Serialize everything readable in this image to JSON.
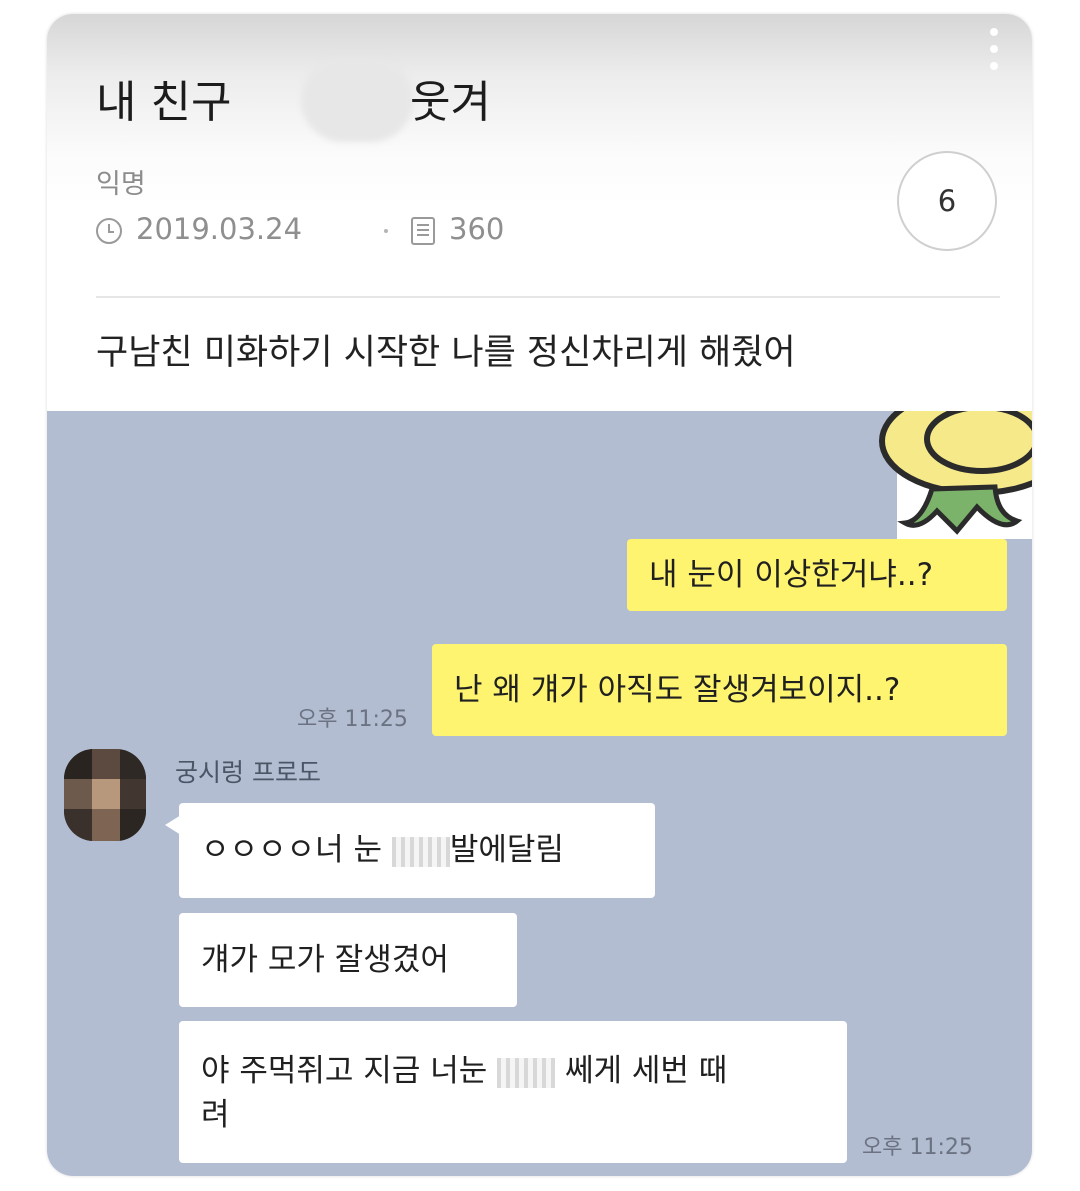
{
  "post": {
    "title_left": "내 친구",
    "title_right": "웃겨",
    "author": "익명",
    "date": "2019.03.24",
    "views": "360",
    "comments": "6",
    "body": "구남친 미화하기 시작한 나를 정신차리게 해줬어"
  },
  "chat": {
    "outgoing": [
      {
        "text": "내 눈이 이상한거냐..?"
      },
      {
        "text": "난 왜 걔가 아직도 잘생겨보이지..?"
      }
    ],
    "outgoing_time": "오후 11:25",
    "sender_name": "궁시렁 프로도",
    "incoming": [
      {
        "before": "ㅇㅇㅇㅇ너 눈 ",
        "after": "발에달림"
      },
      {
        "text": "걔가 모가 잘생겼어"
      },
      {
        "line1_before": "야 주먹쥐고 지금 너눈 ",
        "line1_after": " 쎄게 세번 때",
        "line2": "려"
      }
    ],
    "incoming_time": "오후 11:25"
  },
  "icons": {
    "menu": "more-vertical-icon",
    "date": "clock-icon",
    "views": "document-icon"
  },
  "colors": {
    "chat_background": "#b2bdd1",
    "outgoing_bubble": "#fef470",
    "incoming_bubble": "#ffffff"
  }
}
